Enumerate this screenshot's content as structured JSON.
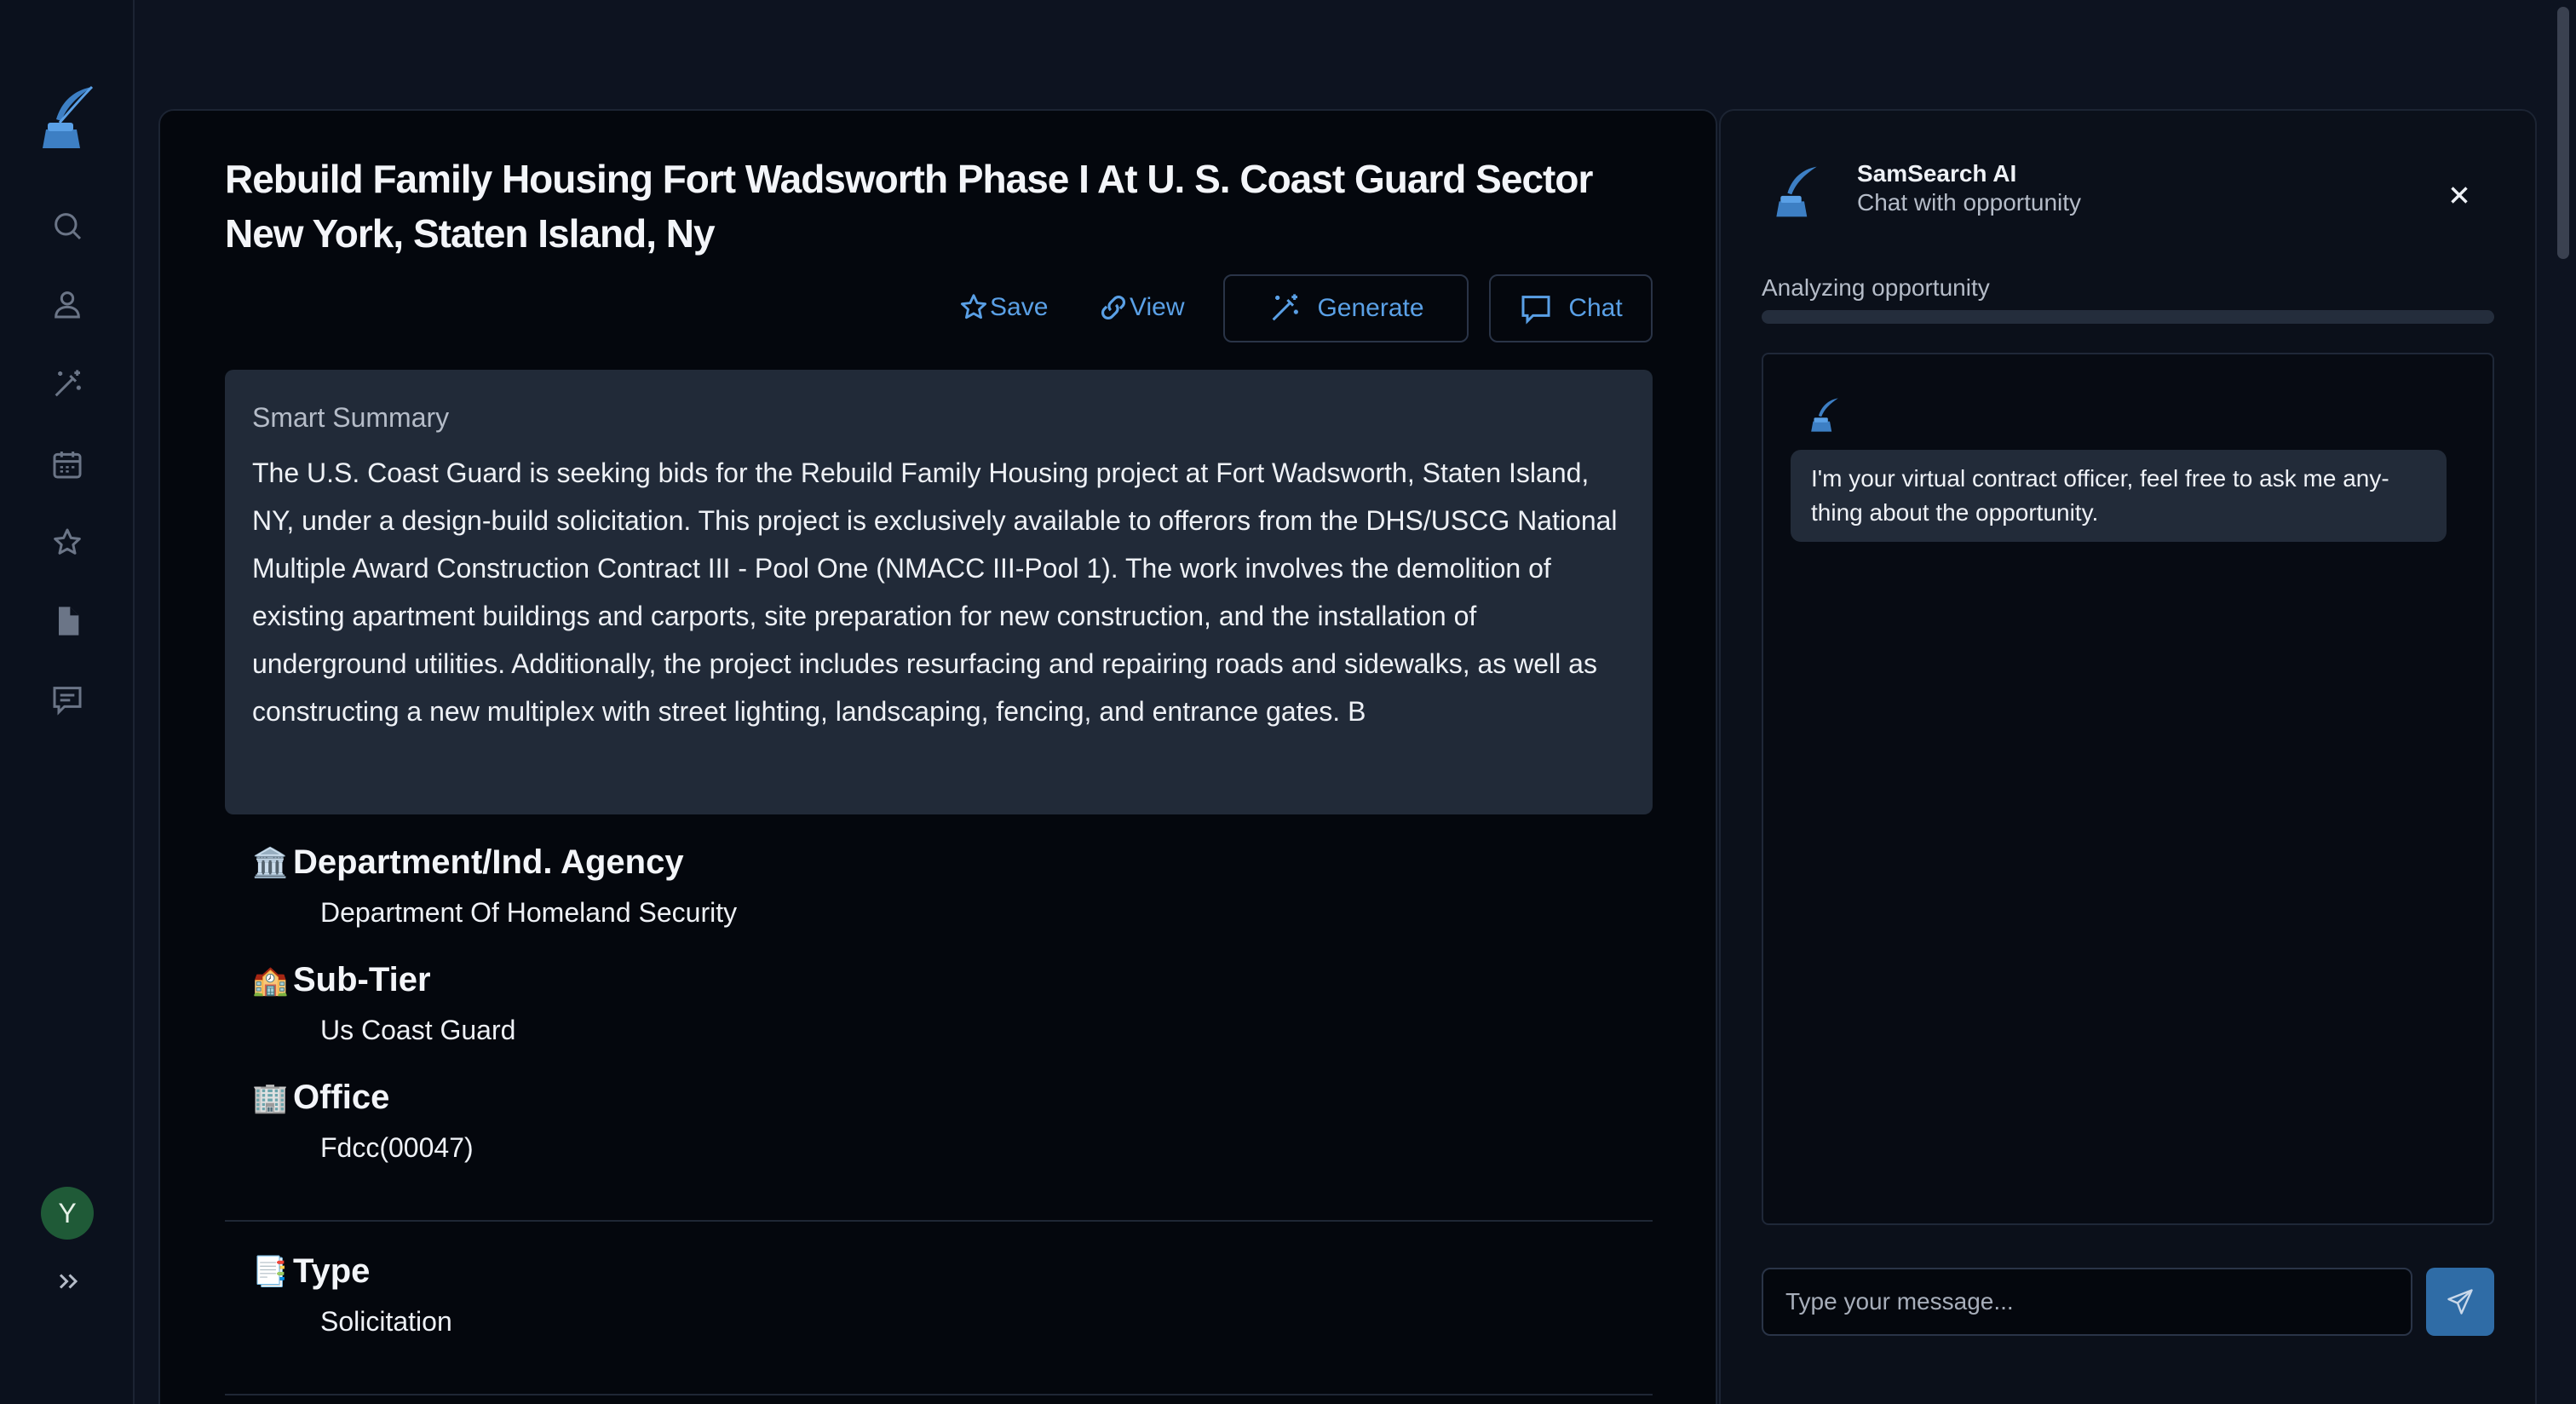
{
  "sidebar": {
    "logo_icon": "quill-inkwell-icon",
    "items": [
      {
        "icon": "search-icon"
      },
      {
        "icon": "user-icon"
      },
      {
        "icon": "magic-wand-icon"
      },
      {
        "icon": "calendar-icon"
      },
      {
        "icon": "star-icon"
      },
      {
        "icon": "document-icon"
      },
      {
        "icon": "message-icon"
      }
    ],
    "avatar_initial": "Y",
    "expand_icon": "chevrons-right-icon"
  },
  "opportunity": {
    "title": "Rebuild Family Housing Fort Wadsworth Phase I At U. S. Coast Guard Sector New York, Staten Island, Ny",
    "actions": {
      "save_label": "Save",
      "view_label": "View",
      "generate_label": "Generate",
      "chat_label": "Chat"
    },
    "summary": {
      "title": "Smart Summary",
      "text": "The U.S. Coast Guard is seeking bids for the Rebuild Family Housing project at Fort Wadsworth, Staten Island, NY, under a design-build solicitation. This project is exclusively available to offerors from the DHS/USCG National Multiple Award Construction Contract III - Pool One (NMACC III-Pool 1). The work involves the demolition of existing apartment buildings and carports, site preparation for new construction, and the installation of underground utilities. Additionally, the project includes resurfacing and repairing roads and sidewalks, as well as constructing a new multiplex with street lighting, landscaping, fencing, and entrance gates. B"
    },
    "details": [
      {
        "emoji": "🏛️",
        "label": "Department/Ind. Agency",
        "value": "Department Of Homeland Security"
      },
      {
        "emoji": "🏫",
        "label": "Sub-Tier",
        "value": "Us Coast Guard"
      },
      {
        "emoji": "🏢",
        "label": "Office",
        "value": "Fdcc(00047)"
      },
      {
        "emoji": "📑",
        "label": "Type",
        "value": "Solicitation"
      }
    ]
  },
  "chat": {
    "name": "SamSearch AI",
    "subtitle": "Chat with opportunity",
    "status": "Analyzing opportunity",
    "progress": 0.0,
    "message": "I'm your virtual contract officer, feel free to ask me any-thing about the opportunity.",
    "input_placeholder": "Type your message...",
    "input_value": ""
  },
  "colors": {
    "accent": "#5aa0e6",
    "background": "#0d1320",
    "card": "#04070d",
    "summary_bg": "#212a38",
    "send_button": "#2f6ca6",
    "avatar_bg": "#1f5a37"
  }
}
